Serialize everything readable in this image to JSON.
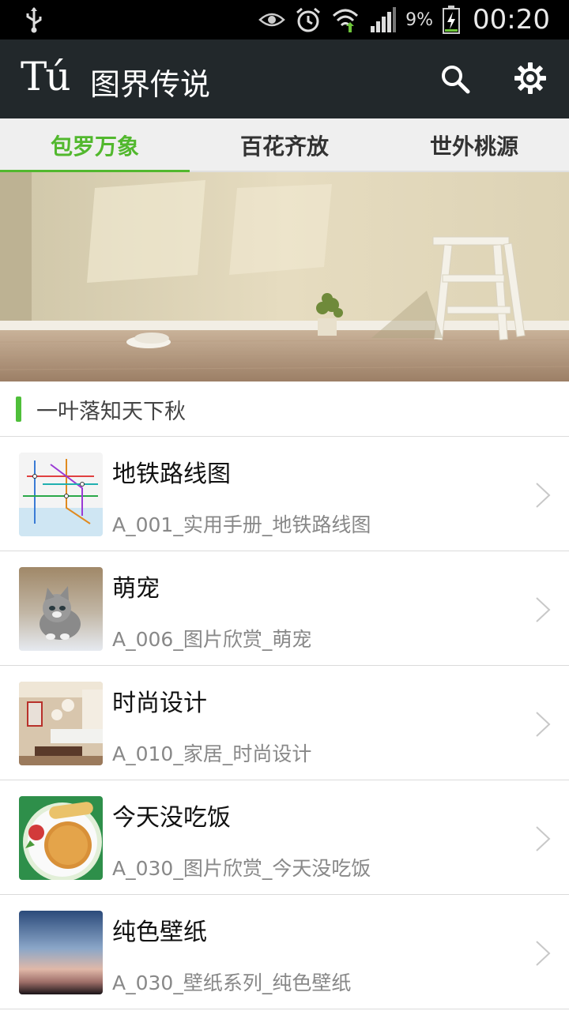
{
  "status_bar": {
    "battery_percent": "9%",
    "time": "00:20",
    "icons": [
      "usb-icon",
      "eye-icon",
      "alarm-icon",
      "wifi-icon",
      "signal-icon",
      "battery-charging-icon"
    ]
  },
  "action_bar": {
    "logo": "Tú",
    "title": "图界传说",
    "icons": [
      "search-icon",
      "settings-icon"
    ]
  },
  "tabs": [
    {
      "label": "包罗万象",
      "active": true
    },
    {
      "label": "百花齐放",
      "active": false
    },
    {
      "label": "世外桃源",
      "active": false
    }
  ],
  "section": {
    "title": "一叶落知天下秋"
  },
  "items": [
    {
      "title": "地铁路线图",
      "subtitle": "A_001_实用手册_地铁路线图",
      "thumb": "subway-map"
    },
    {
      "title": "萌宠",
      "subtitle": "A_006_图片欣赏_萌宠",
      "thumb": "kitten"
    },
    {
      "title": "时尚设计",
      "subtitle": "A_010_家居_时尚设计",
      "thumb": "living-room"
    },
    {
      "title": "今天没吃饭",
      "subtitle": "A_030_图片欣赏_今天没吃饭",
      "thumb": "food"
    },
    {
      "title": "纯色壁纸",
      "subtitle": "A_030_壁纸系列_纯色壁纸",
      "thumb": "gradient"
    }
  ],
  "colors": {
    "accent": "#52b82e",
    "action_bar": "#22282b",
    "tab_bar": "#efefef"
  }
}
